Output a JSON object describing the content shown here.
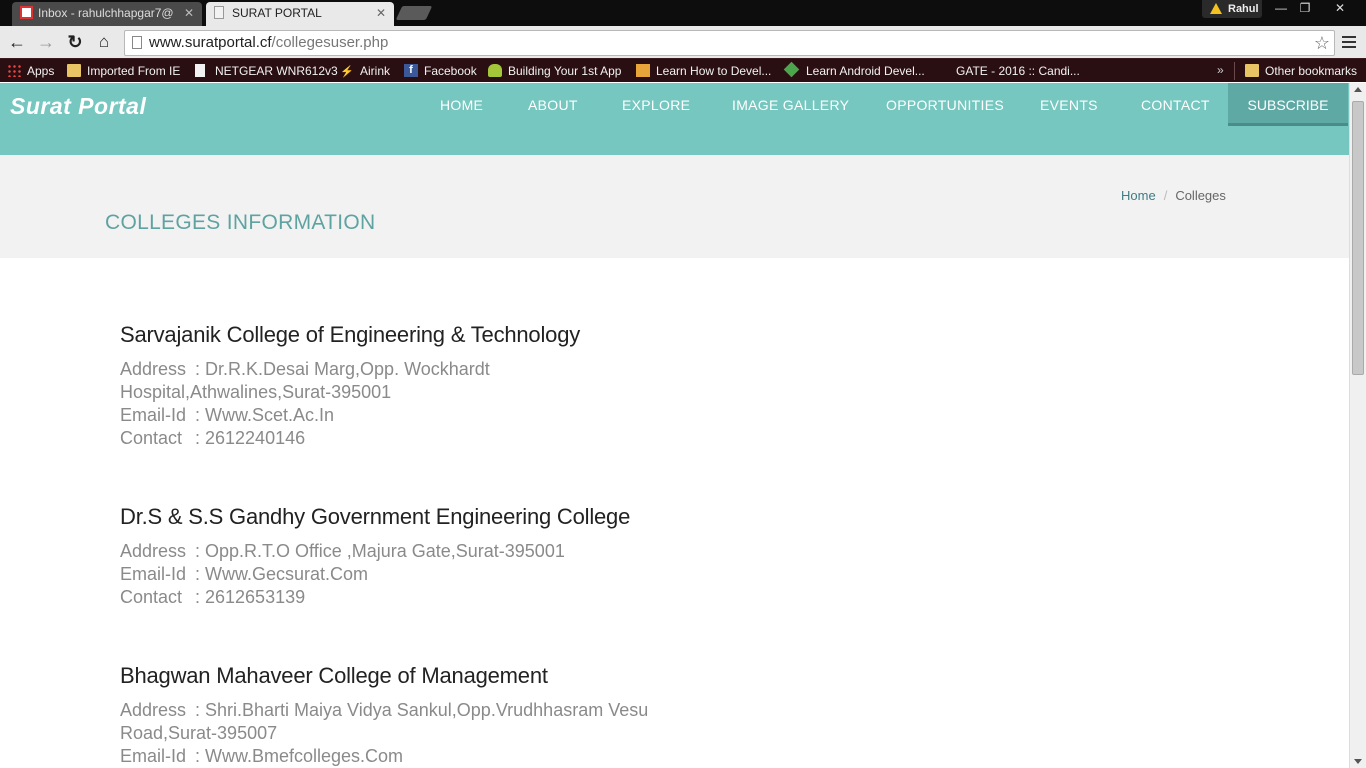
{
  "browser": {
    "tabs": [
      {
        "title": "Inbox - rahulchhapgar7@"
      },
      {
        "title": "SURAT PORTAL"
      }
    ],
    "profile_name": "Rahul",
    "window_buttons": {
      "minimize": "—",
      "restore": "❐",
      "close": "✕"
    },
    "url_domain": "www.suratportal.cf",
    "url_path": "/collegesuser.php",
    "bookmarks": [
      {
        "label": "Apps"
      },
      {
        "label": "Imported From IE"
      },
      {
        "label": "NETGEAR WNR612v3"
      },
      {
        "label": "Airink"
      },
      {
        "label": "Facebook"
      },
      {
        "label": "Building Your 1st App"
      },
      {
        "label": "Learn How to Devel..."
      },
      {
        "label": "Learn Android Devel..."
      },
      {
        "label": "GATE - 2016 :: Candi..."
      }
    ],
    "bookmarks_overflow": "»",
    "other_bookmarks": "Other bookmarks"
  },
  "site": {
    "logo": "Surat  Portal",
    "nav": [
      "HOME",
      "ABOUT",
      "EXPLORE",
      "IMAGE GALLERY",
      "OPPORTUNITIES",
      "EVENTS",
      "CONTACT"
    ],
    "subscribe": "SUBSCRIBE",
    "page_title": "COLLEGES INFORMATION",
    "breadcrumb": {
      "home": "Home",
      "separator": "/",
      "current": "Colleges"
    }
  },
  "labels": {
    "address": "Address",
    "email": "Email-Id",
    "contact": "Contact"
  },
  "colleges": [
    {
      "name": "Sarvajanik College of Engineering & Technology",
      "address": ": Dr.R.K.Desai Marg,Opp. Wockhardt Hospital,Athwalines,Surat-395001",
      "email": ": Www.Scet.Ac.In",
      "contact": ": 2612240146"
    },
    {
      "name": "Dr.S & S.S Gandhy Government Engineering College",
      "address": ": Opp.R.T.O Office ,Majura Gate,Surat-395001",
      "email": ": Www.Gecsurat.Com",
      "contact": ": 2612653139"
    },
    {
      "name": "Bhagwan Mahaveer College of Management",
      "address": ": Shri.Bharti Maiya Vidya Sankul,Opp.Vrudhhasram Vesu Road,Surat-395007",
      "email": ": Www.Bmefcolleges.Com",
      "contact": ""
    }
  ]
}
